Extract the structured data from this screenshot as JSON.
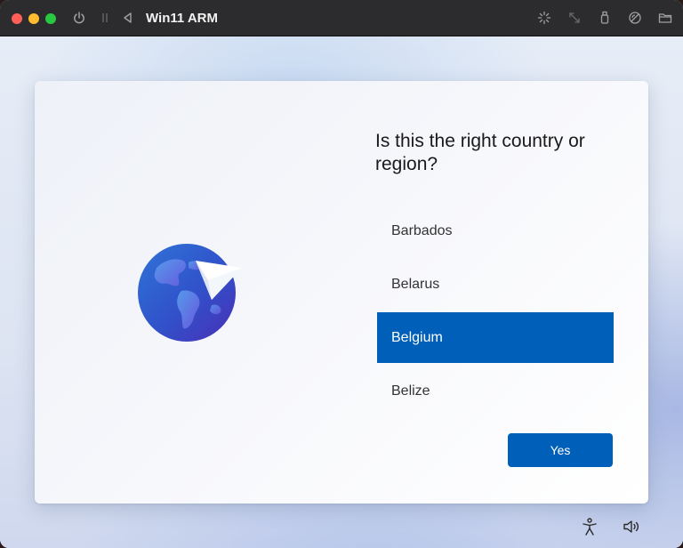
{
  "window": {
    "title": "Win11 ARM"
  },
  "titlebar": {
    "icons": [
      "power-icon",
      "pause-icon",
      "back-icon",
      "loading-icon",
      "resize-icon",
      "usb-icon",
      "network-icon",
      "folder-icon"
    ]
  },
  "setup": {
    "question": "Is this the right country or region?",
    "countries": [
      {
        "label": "Barbados",
        "selected": false
      },
      {
        "label": "Belarus",
        "selected": false
      },
      {
        "label": "Belgium",
        "selected": true
      },
      {
        "label": "Belize",
        "selected": false
      }
    ],
    "yes_label": "Yes"
  },
  "footer": {
    "icons": [
      "accessibility-icon",
      "volume-icon"
    ]
  },
  "colors": {
    "accent": "#005fb8",
    "titlebar": "#2c2c2e",
    "close": "#ff5f57",
    "minimize": "#febc2e",
    "maximize": "#28c840"
  }
}
